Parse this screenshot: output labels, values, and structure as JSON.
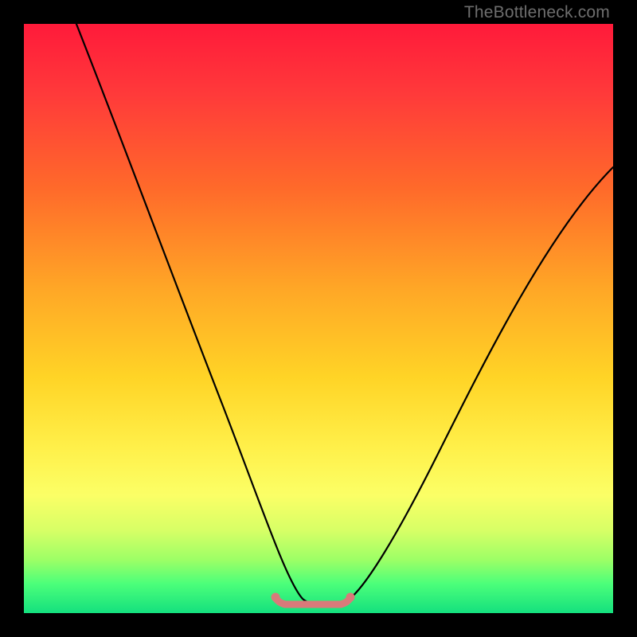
{
  "watermark": "TheBottleneck.com",
  "chart_data": {
    "type": "line",
    "title": "",
    "xlabel": "",
    "ylabel": "",
    "xlim": [
      0,
      100
    ],
    "ylim": [
      0,
      100
    ],
    "series": [
      {
        "name": "bottleneck-curve",
        "x": [
          0,
          5,
          10,
          15,
          20,
          25,
          30,
          35,
          40,
          45,
          47,
          50,
          53,
          55,
          57,
          60,
          65,
          70,
          75,
          80,
          85,
          90,
          95,
          100
        ],
        "values": [
          104,
          94,
          84,
          73,
          62,
          51,
          40,
          29,
          18,
          7,
          3,
          1,
          1,
          2,
          3,
          6,
          13,
          22,
          32,
          42,
          53,
          63,
          71,
          76
        ]
      }
    ],
    "flat_region": {
      "x_start": 42,
      "x_end": 58,
      "y": 2,
      "color": "#d97a7a"
    },
    "gradient_stops": [
      {
        "pos": 0,
        "color": "#ff1a3a"
      },
      {
        "pos": 12,
        "color": "#ff3a3a"
      },
      {
        "pos": 28,
        "color": "#ff6a2a"
      },
      {
        "pos": 45,
        "color": "#ffa726"
      },
      {
        "pos": 60,
        "color": "#ffd426"
      },
      {
        "pos": 72,
        "color": "#fff04a"
      },
      {
        "pos": 80,
        "color": "#fbff66"
      },
      {
        "pos": 86,
        "color": "#d7ff66"
      },
      {
        "pos": 91,
        "color": "#9cff66"
      },
      {
        "pos": 95,
        "color": "#4cff7a"
      },
      {
        "pos": 100,
        "color": "#14e07e"
      }
    ]
  }
}
